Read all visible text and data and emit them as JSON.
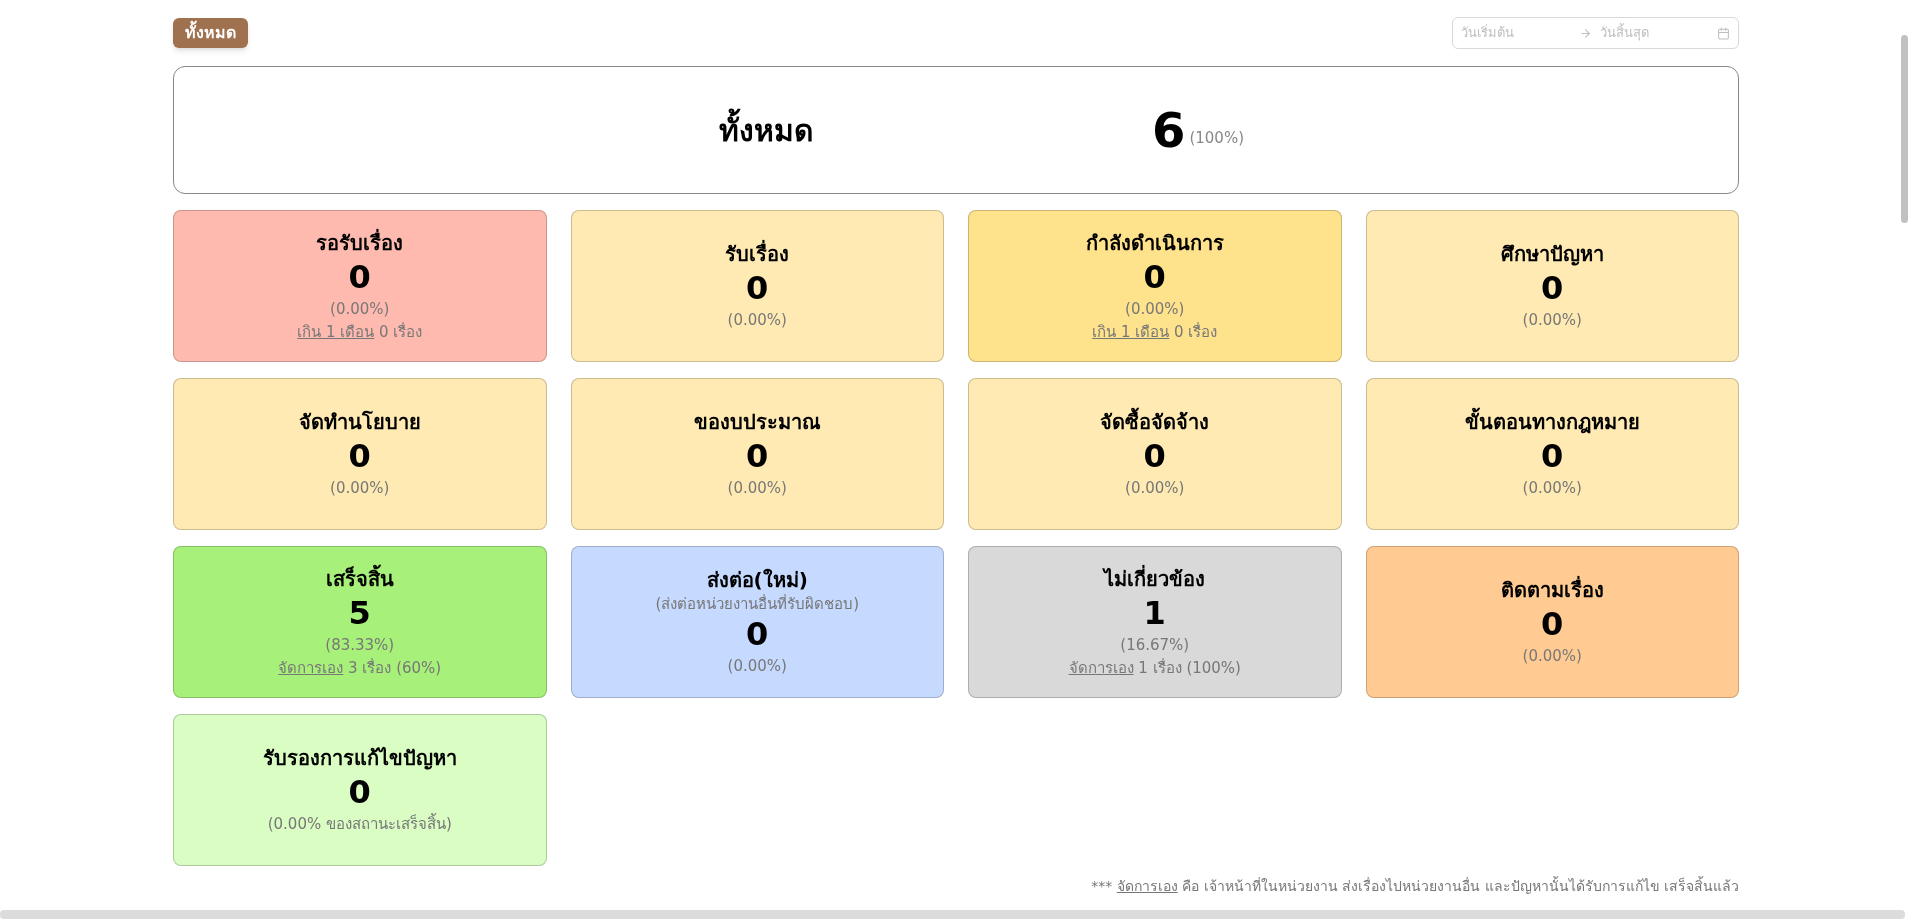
{
  "filter_button": {
    "label": "ทั้งหมด"
  },
  "date_range": {
    "start_placeholder": "วันเริ่มต้น",
    "end_placeholder": "วันสิ้นสุด"
  },
  "summary": {
    "label": "ทั้งหมด",
    "count": "6",
    "percent": "(100%)"
  },
  "cards": [
    {
      "title": "รอรับเรื่อง",
      "count": "0",
      "percent": "(0.00%)",
      "note": {
        "link": "เกิน 1 เดือน",
        "text": "0 เรื่อง"
      },
      "color": "#ffbab0"
    },
    {
      "title": "รับเรื่อง",
      "count": "0",
      "percent": "(0.00%)",
      "color": "#ffeab3"
    },
    {
      "title": "กำลังดำเนินการ",
      "count": "0",
      "percent": "(0.00%)",
      "note": {
        "link": "เกิน 1 เดือน",
        "text": "0 เรื่อง"
      },
      "color": "#ffe28c"
    },
    {
      "title": "ศึกษาปัญหา",
      "count": "0",
      "percent": "(0.00%)",
      "color": "#ffeab3"
    },
    {
      "title": "จัดทำนโยบาย",
      "count": "0",
      "percent": "(0.00%)",
      "color": "#ffeab3"
    },
    {
      "title": "ของบประมาณ",
      "count": "0",
      "percent": "(0.00%)",
      "color": "#ffeab3"
    },
    {
      "title": "จัดซื้อจัดจ้าง",
      "count": "0",
      "percent": "(0.00%)",
      "color": "#ffeab3"
    },
    {
      "title": "ขั้นตอนทางกฎหมาย",
      "count": "0",
      "percent": "(0.00%)",
      "color": "#ffeab3"
    },
    {
      "title": "เสร็จสิ้น",
      "count": "5",
      "percent": "(83.33%)",
      "note": {
        "link": "จัดการเอง",
        "text": "3 เรื่อง (60%)"
      },
      "color": "#a7f07a"
    },
    {
      "title": "ส่งต่อ(ใหม่)",
      "subtitle": "(ส่งต่อหน่วยงานอื่นที่รับผิดชอบ)",
      "count": "0",
      "percent": "(0.00%)",
      "color": "#c6d9ff"
    },
    {
      "title": "ไม่เกี่ยวข้อง",
      "count": "1",
      "percent": "(16.67%)",
      "note": {
        "link": "จัดการเอง",
        "text": "1 เรื่อง (100%)"
      },
      "color": "#d9d9d9"
    },
    {
      "title": "ติดตามเรื่อง",
      "count": "0",
      "percent": "(0.00%)",
      "color": "#ffcb92"
    },
    {
      "title": "รับรองการแก้ไขปัญหา",
      "count": "0",
      "percent": "(0.00% ของสถานะเสร็จสิ้น)",
      "color": "#d9fdc2"
    }
  ],
  "footnote": {
    "prefix": "***",
    "link": "จัดการเอง",
    "text": "คือ เจ้าหน้าที่ในหน่วยงาน ส่งเรื่องไปหน่วยงานอื่น และปัญหานั้นได้รับการแก้ไข เสร็จสิ้นแล้ว"
  }
}
